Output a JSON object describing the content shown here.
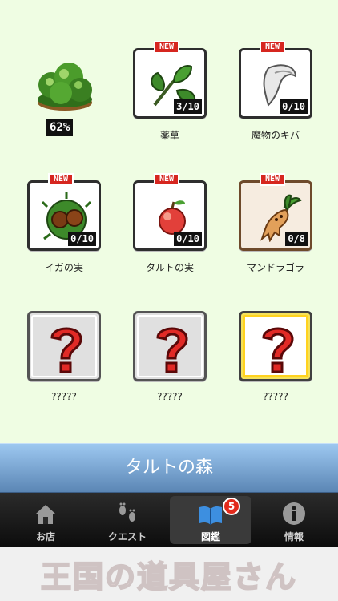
{
  "progress": {
    "percent_label": "62%",
    "value": 0.62
  },
  "items": [
    {
      "name": "薬草",
      "count": "3/10",
      "new": true,
      "style": "plain"
    },
    {
      "name": "魔物のキバ",
      "count": "0/10",
      "new": true,
      "style": "plain"
    },
    {
      "name": "イガの実",
      "count": "0/10",
      "new": true,
      "style": "plain"
    },
    {
      "name": "タルトの実",
      "count": "0/10",
      "new": true,
      "style": "plain"
    },
    {
      "name": "マンドラゴラ",
      "count": "0/8",
      "new": true,
      "style": "bronze"
    },
    {
      "name": "?????",
      "style": "mystery"
    },
    {
      "name": "?????",
      "style": "mystery"
    },
    {
      "name": "?????",
      "style": "gold"
    }
  ],
  "new_badge_label": "NEW",
  "location": "タルトの森",
  "tabs": [
    {
      "label": "お店",
      "icon": "house-icon"
    },
    {
      "label": "クエスト",
      "icon": "footprints-icon"
    },
    {
      "label": "図鑑",
      "icon": "book-icon",
      "badge": "5",
      "active": true
    },
    {
      "label": "情報",
      "icon": "info-icon"
    }
  ],
  "footer_title": "王国の道具屋さん",
  "colors": {
    "background": "#effde3",
    "location_bar": "#6f9ac6",
    "new_badge": "#d6261f",
    "tab_badge": "#e22a1c",
    "gold_frame": "#ffd21f"
  }
}
